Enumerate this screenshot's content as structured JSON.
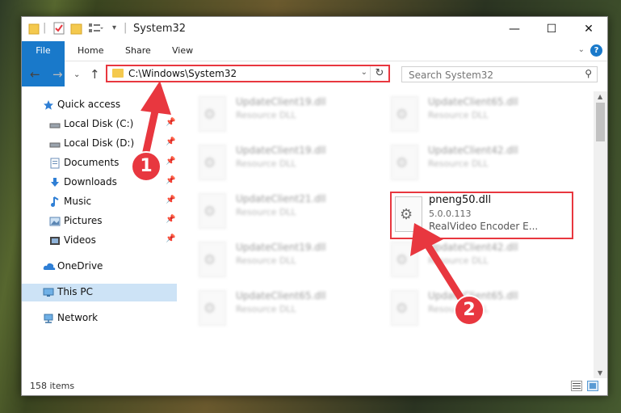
{
  "window": {
    "title": "System32",
    "controls": {
      "minimize": "—",
      "maximize": "☐",
      "close": "✕"
    }
  },
  "ribbon": {
    "tabs": [
      "File",
      "Home",
      "Share",
      "View"
    ],
    "help": "?"
  },
  "address": {
    "path": "C:\\Windows\\System32",
    "search_placeholder": "Search System32"
  },
  "sidebar": {
    "items": [
      {
        "label": "Quick access",
        "icon": "star-icon",
        "pinned": false
      },
      {
        "label": "Local Disk (C:)",
        "icon": "drive-icon",
        "pinned": true
      },
      {
        "label": "Local Disk (D:)",
        "icon": "drive-icon",
        "pinned": true
      },
      {
        "label": "Documents",
        "icon": "documents-icon",
        "pinned": true
      },
      {
        "label": "Downloads",
        "icon": "download-icon",
        "pinned": true
      },
      {
        "label": "Music",
        "icon": "music-icon",
        "pinned": true
      },
      {
        "label": "Pictures",
        "icon": "pictures-icon",
        "pinned": true
      },
      {
        "label": "Videos",
        "icon": "videos-icon",
        "pinned": true
      },
      {
        "label": "OneDrive",
        "icon": "cloud-icon",
        "pinned": false
      },
      {
        "label": "This PC",
        "icon": "computer-icon",
        "pinned": false,
        "selected": true
      },
      {
        "label": "Network",
        "icon": "network-icon",
        "pinned": false
      }
    ]
  },
  "files": {
    "background": [
      {
        "name": "UpdateClient19.dll",
        "desc": "Resource DLL"
      },
      {
        "name": "UpdateClient65.dll",
        "desc": "Resource DLL"
      },
      {
        "name": "UpdateClient19.dll",
        "desc": "Resource DLL"
      },
      {
        "name": "UpdateClient42.dll",
        "desc": "Resource DLL"
      },
      {
        "name": "UpdateClient21.dll",
        "desc": "Resource DLL"
      },
      {
        "name": "UpdateClient42.dll",
        "desc": "Resource DLL"
      },
      {
        "name": "UpdateClient19.dll",
        "desc": "Resource DLL"
      },
      {
        "name": "UpdateClient65.dll",
        "desc": "Resource DLL"
      },
      {
        "name": "UpdateClient65.dll",
        "desc": "Resource DLL"
      }
    ],
    "highlighted": {
      "name": "pneng50.dll",
      "version": "5.0.0.113",
      "description": "RealVideo Encoder E..."
    }
  },
  "status": {
    "item_count": "158 items"
  },
  "annotations": {
    "step1": "1",
    "step2": "2",
    "color": "#e8373f"
  }
}
